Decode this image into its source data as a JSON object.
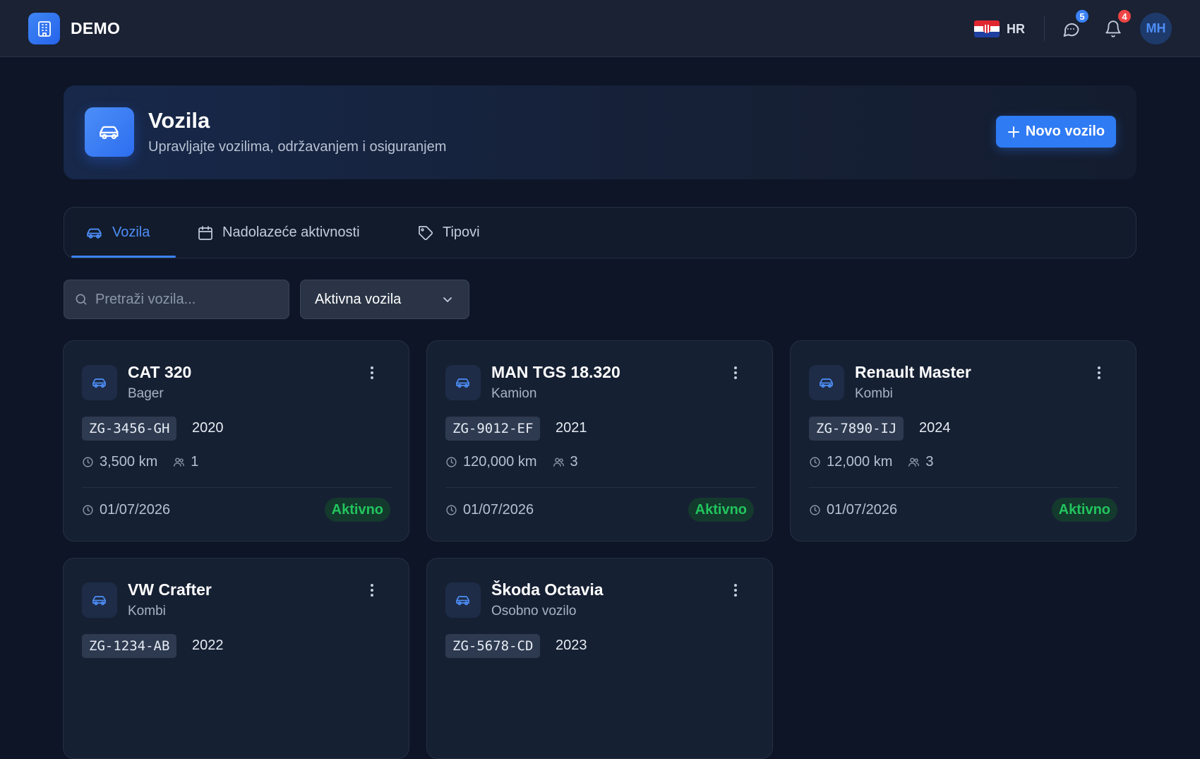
{
  "app": {
    "name": "DEMO"
  },
  "topbar": {
    "language": "HR",
    "messages_count": "5",
    "notifications_count": "4",
    "avatar_initials": "MH"
  },
  "colors": {
    "accent": "#2f7bf4",
    "background": "#0d1526",
    "status_active": "#22c55e",
    "badge_messages": "#3b82f6",
    "badge_notifications": "#ef4444"
  },
  "header": {
    "icon": "car-icon",
    "title": "Vozila",
    "subtitle": "Upravljajte vozilima, održavanjem i osiguranjem",
    "new_button_label": "Novo vozilo"
  },
  "tabs": [
    {
      "label": "Vozila",
      "icon": "car-icon",
      "active": true
    },
    {
      "label": "Nadolazeće aktivnosti",
      "icon": "calendar-icon",
      "active": false
    },
    {
      "label": "Tipovi",
      "icon": "tag-icon",
      "active": false
    }
  ],
  "filters": {
    "search_placeholder": "Pretraži vozila...",
    "status_selected": "Aktivna vozila"
  },
  "vehicles": [
    {
      "name": "CAT 320",
      "type": "Bager",
      "plate": "ZG-3456-GH",
      "year": "2020",
      "mileage": "3,500 km",
      "users": "1",
      "date": "01/07/2026",
      "status": "Aktivno"
    },
    {
      "name": "MAN TGS 18.320",
      "type": "Kamion",
      "plate": "ZG-9012-EF",
      "year": "2021",
      "mileage": "120,000 km",
      "users": "3",
      "date": "01/07/2026",
      "status": "Aktivno"
    },
    {
      "name": "Renault Master",
      "type": "Kombi",
      "plate": "ZG-7890-IJ",
      "year": "2024",
      "mileage": "12,000 km",
      "users": "3",
      "date": "01/07/2026",
      "status": "Aktivno"
    },
    {
      "name": "VW Crafter",
      "type": "Kombi",
      "plate": "ZG-1234-AB",
      "year": "2022"
    },
    {
      "name": "Škoda Octavia",
      "type": "Osobno vozilo",
      "plate": "ZG-5678-CD",
      "year": "2023"
    }
  ]
}
